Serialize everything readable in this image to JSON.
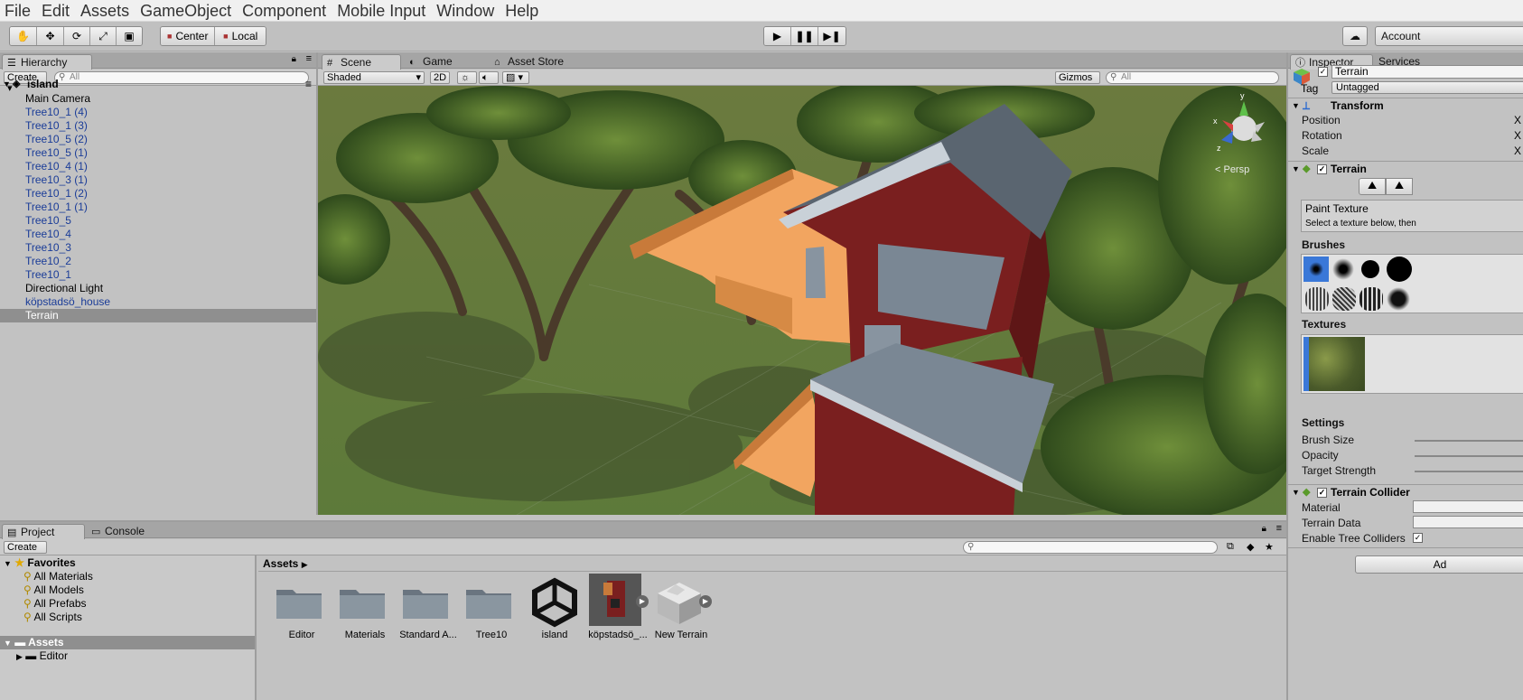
{
  "menu": [
    "File",
    "Edit",
    "Assets",
    "GameObject",
    "Component",
    "Mobile Input",
    "Window",
    "Help"
  ],
  "toolbar": {
    "pivot_center": "Center",
    "pivot_local": "Local",
    "account": "Account"
  },
  "hierarchy": {
    "tab": "Hierarchy",
    "create": "Create",
    "search_placeholder": "All",
    "scene": "island",
    "items": [
      {
        "label": "Main Camera",
        "type": "obj"
      },
      {
        "label": "Tree10_1 (4)",
        "type": "prefab"
      },
      {
        "label": "Tree10_1 (3)",
        "type": "prefab"
      },
      {
        "label": "Tree10_5 (2)",
        "type": "prefab"
      },
      {
        "label": "Tree10_5 (1)",
        "type": "prefab"
      },
      {
        "label": "Tree10_4 (1)",
        "type": "prefab"
      },
      {
        "label": "Tree10_3 (1)",
        "type": "prefab"
      },
      {
        "label": "Tree10_1 (2)",
        "type": "prefab"
      },
      {
        "label": "Tree10_1 (1)",
        "type": "prefab"
      },
      {
        "label": "Tree10_5",
        "type": "prefab"
      },
      {
        "label": "Tree10_4",
        "type": "prefab"
      },
      {
        "label": "Tree10_3",
        "type": "prefab"
      },
      {
        "label": "Tree10_2",
        "type": "prefab"
      },
      {
        "label": "Tree10_1",
        "type": "prefab"
      },
      {
        "label": "Directional Light",
        "type": "obj"
      },
      {
        "label": "köpstadsö_house",
        "type": "prefab"
      },
      {
        "label": "Terrain",
        "type": "selected"
      }
    ]
  },
  "scene": {
    "tabs": [
      "Scene",
      "Game",
      "Asset Store"
    ],
    "shading": "Shaded",
    "mode_2d": "2D",
    "gizmos": "Gizmos",
    "search_placeholder": "All",
    "persp_label": "< Persp"
  },
  "inspector": {
    "tabs": [
      "Inspector",
      "Services"
    ],
    "object_name": "Terrain",
    "tag_label": "Tag",
    "tag_value": "Untagged",
    "transform": {
      "title": "Transform",
      "fields": [
        "Position",
        "Rotation",
        "Scale"
      ]
    },
    "terrain": {
      "title": "Terrain",
      "paint_title": "Paint Texture",
      "paint_hint": "Select a texture below, then",
      "brushes_label": "Brushes",
      "textures_label": "Textures",
      "settings_label": "Settings",
      "settings": [
        "Brush Size",
        "Opacity",
        "Target Strength"
      ]
    },
    "collider": {
      "title": "Terrain Collider",
      "fields": [
        "Material",
        "Terrain Data",
        "Enable Tree Colliders"
      ]
    },
    "add_component": "Ad"
  },
  "project": {
    "tabs": [
      "Project",
      "Console"
    ],
    "create": "Create",
    "favorites_label": "Favorites",
    "favorites": [
      "All Materials",
      "All Models",
      "All Prefabs",
      "All Scripts"
    ],
    "assets_root": "Assets",
    "assets_child": "Editor",
    "breadcrumb": "Assets",
    "items": [
      {
        "label": "Editor",
        "kind": "folder"
      },
      {
        "label": "Materials",
        "kind": "folder"
      },
      {
        "label": "Standard A...",
        "kind": "folder"
      },
      {
        "label": "Tree10",
        "kind": "folder"
      },
      {
        "label": "island",
        "kind": "unity-scene"
      },
      {
        "label": "köpstadsö_...",
        "kind": "prefab"
      },
      {
        "label": "New Terrain",
        "kind": "terrain"
      }
    ]
  },
  "colors": {
    "accent_selection": "#8f8f8f",
    "prefab_text": "#1a3c98",
    "barn_red": "#7a1f1f",
    "deck_orange": "#f0a050"
  }
}
